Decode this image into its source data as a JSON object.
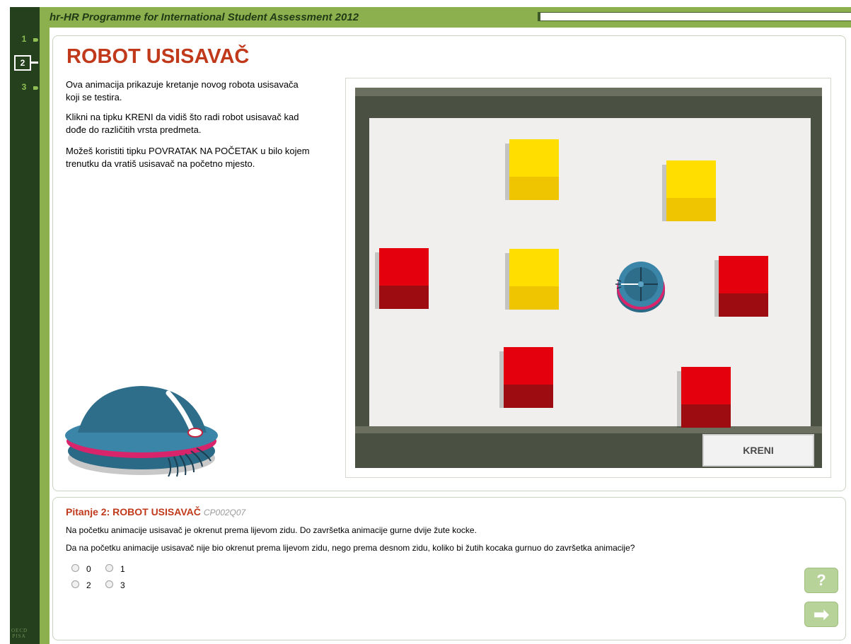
{
  "header": {
    "title": "hr-HR Programme for International Student Assessment 2012"
  },
  "nav": {
    "items": [
      "1",
      "2",
      "3"
    ],
    "current": "2"
  },
  "branding": {
    "org_line1": "OECD",
    "org_line2": "PISA"
  },
  "stimulus": {
    "title": "ROBOT USISAVAČ",
    "paragraphs": [
      "Ova animacija prikazuje kretanje novog robota usisavača koji se testira.",
      "Klikni na tipku KRENI da vidiš što radi robot usisavač kad dođe do različitih vrsta predmeta.",
      "Možeš koristiti tipku POVRATAK NA POČETAK u bilo kojem trenutku da vratiš usisavač na početno mjesto."
    ],
    "start_button": "KRENI"
  },
  "question": {
    "heading": "Pitanje 2: ROBOT USISAVAČ",
    "code": "CP002Q07",
    "text1": "Na početku animacije usisavač je okrenut prema lijevom zidu. Do završetka animacije gurne dvije žute kocke.",
    "text2": "Da na početku animacije usisavač nije bio okrenut prema lijevom zidu, nego prema desnom zidu, koliko bi žutih kocaka gurnuo do završetka animacije?",
    "options": [
      "0",
      "1",
      "2",
      "3"
    ]
  },
  "buttons": {
    "help": "?",
    "next": "➡"
  },
  "colors": {
    "title_red": "#c0391b",
    "sidebar_green": "#24401d",
    "header_green": "#8db04f",
    "cube_yellow": "#ffde00",
    "cube_red": "#e4000c",
    "robot_blue": "#2f6e8a",
    "button_green": "#b8d39a"
  },
  "icons": {
    "help": "question-icon",
    "next": "arrow-right-icon"
  }
}
